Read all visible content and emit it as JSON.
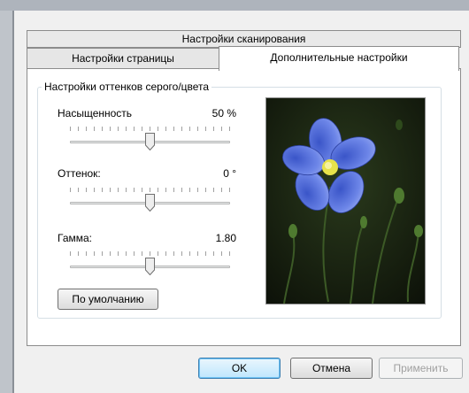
{
  "tabs": {
    "scan_settings": "Настройки сканирования",
    "page_settings": "Настройки страницы",
    "advanced_settings": "Дополнительные настройки"
  },
  "group": {
    "title": "Настройки оттенков серого/цвета"
  },
  "saturation": {
    "label": "Насыщенность",
    "value_text": "50 %",
    "level": 0.5
  },
  "hue": {
    "label": "Оттенок:",
    "value_text": "0 °",
    "level": 0.5
  },
  "gamma": {
    "label": "Гамма:",
    "value_text": "1.80",
    "level": 0.5
  },
  "buttons": {
    "default": "По умолчанию",
    "ok": "OK",
    "cancel": "Отмена",
    "apply": "Применить"
  },
  "preview": {
    "subject": "blue flax flower photo"
  },
  "colors": {
    "ok_border": "#3c7fb1",
    "disabled_text": "#a0a0a0",
    "panel_bg": "#ffffff"
  }
}
